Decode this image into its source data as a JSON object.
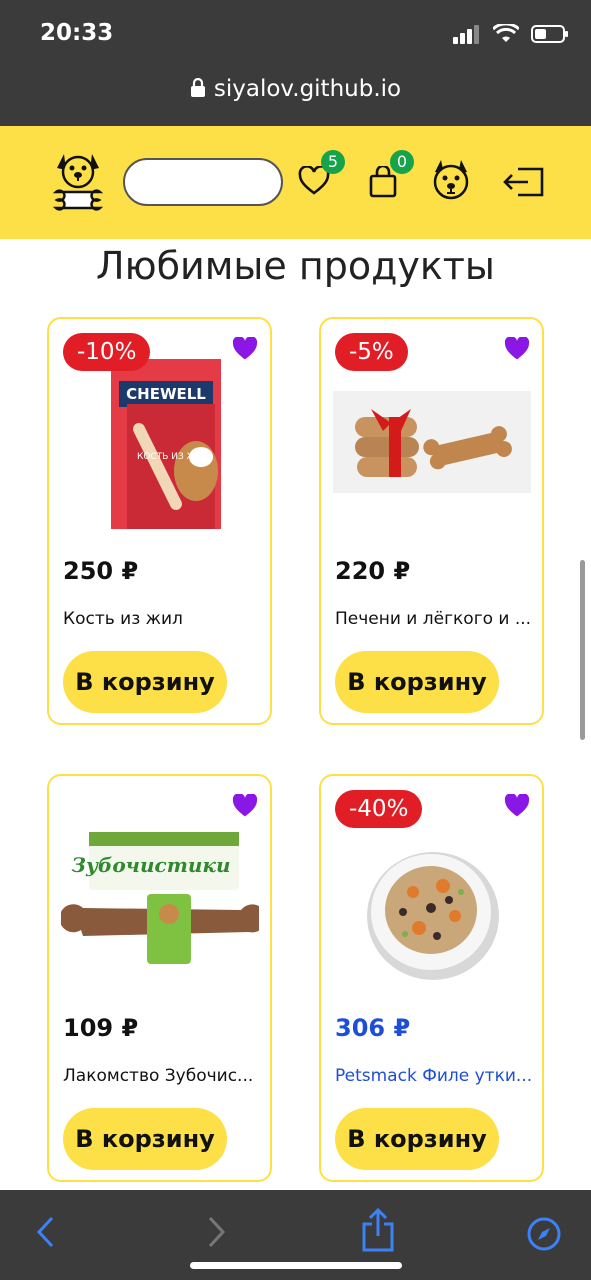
{
  "status": {
    "time": "20:33"
  },
  "browser": {
    "url": "siyalov.github.io"
  },
  "header": {
    "search_value": "",
    "favorites_count": "5",
    "cart_count": "0"
  },
  "page": {
    "title": "Любимые продукты"
  },
  "products": [
    {
      "discount": "-10%",
      "price": "250 ₽",
      "name": "Кость из жил",
      "button": "В корзину"
    },
    {
      "discount": "-5%",
      "price": "220 ₽",
      "name": "Печени и лёгкого и ...",
      "button": "В корзину"
    },
    {
      "discount": "",
      "price": "109 ₽",
      "name": "Лакомство Зубочис...",
      "button": "В корзину"
    },
    {
      "discount": "-40%",
      "price": "306 ₽",
      "name": "Petsmack Филе утки...",
      "button": "В корзину"
    }
  ],
  "images": {
    "p1_brand": "CHEWELL",
    "p1_text": "КОСТЬ ИЗ ЖИЛ",
    "p3_brand": "Зубочистики"
  },
  "icons": [
    "lock-icon",
    "dog-bone-logo-icon",
    "heart-icon",
    "bag-icon",
    "dog-face-icon",
    "logout-icon",
    "back-icon",
    "forward-icon",
    "share-icon",
    "compass-icon"
  ],
  "colors": {
    "accent": "#fde047",
    "discount": "#e11d25",
    "favorite": "#8b17e6",
    "badge": "#16a34a",
    "link": "#1d4ed8"
  }
}
